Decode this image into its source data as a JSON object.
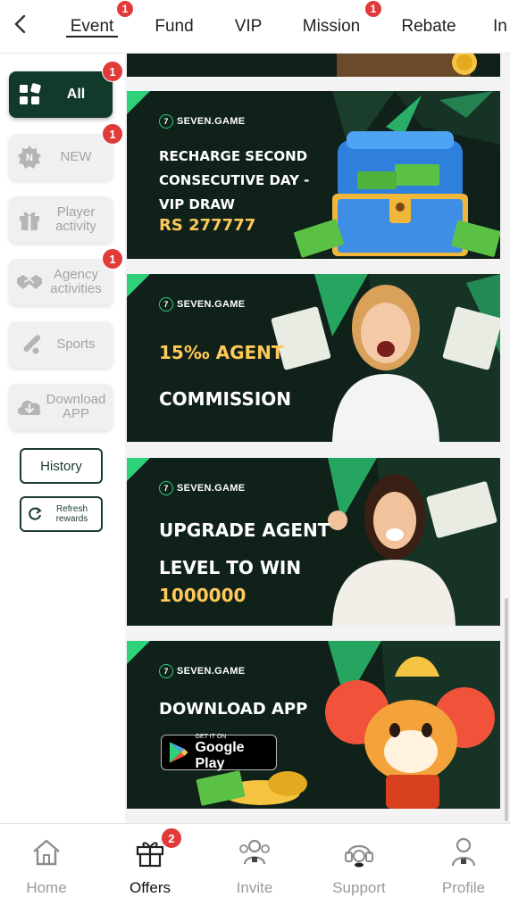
{
  "tabs": [
    {
      "label": "Event",
      "active": true,
      "badge": "1"
    },
    {
      "label": "Fund",
      "active": false,
      "badge": ""
    },
    {
      "label": "VIP",
      "active": false,
      "badge": ""
    },
    {
      "label": "Mission",
      "active": false,
      "badge": "1"
    },
    {
      "label": "Rebate",
      "active": false,
      "badge": ""
    },
    {
      "label": "In",
      "active": false,
      "badge": ""
    }
  ],
  "sidebar": {
    "items": [
      {
        "label": "All",
        "icon": "grid-icon",
        "badge": "1",
        "active": true
      },
      {
        "label": "NEW",
        "icon": "new-gear-icon",
        "badge": "1",
        "active": false
      },
      {
        "label": "Player activity",
        "icon": "gift-icon",
        "badge": "",
        "active": false
      },
      {
        "label": "Agency activities",
        "icon": "handshake-icon",
        "badge": "1",
        "active": false
      },
      {
        "label": "Sports",
        "icon": "bat-icon",
        "badge": "",
        "active": false
      },
      {
        "label": "Download APP",
        "icon": "cloud-download-icon",
        "badge": "",
        "active": false
      }
    ],
    "history_label": "History",
    "refresh_label": "Refresh rewards"
  },
  "banners": [
    {
      "brand": "SEVEN.GAME",
      "lines": [
        "RECHARGE SECOND",
        "CONSECUTIVE DAY -",
        "VIP DRAW"
      ],
      "highlight": "RS 277777"
    },
    {
      "brand": "SEVEN.GAME",
      "lines": [
        "15‰ AGENT",
        "COMMISSION"
      ],
      "highlight": ""
    },
    {
      "brand": "SEVEN.GAME",
      "lines": [
        "UPGRADE AGENT",
        "LEVEL TO WIN"
      ],
      "highlight": "1000000"
    },
    {
      "brand": "SEVEN.GAME",
      "lines": [
        "DOWNLOAD APP"
      ],
      "highlight": "",
      "store_small": "GET IT ON",
      "store_big": "Google Play"
    }
  ],
  "bottom_nav": [
    {
      "label": "Home",
      "icon": "home-icon",
      "active": false,
      "badge": ""
    },
    {
      "label": "Offers",
      "icon": "gift-box-icon",
      "active": true,
      "badge": "2"
    },
    {
      "label": "Invite",
      "icon": "people-icon",
      "active": false,
      "badge": ""
    },
    {
      "label": "Support",
      "icon": "headset-icon",
      "active": false,
      "badge": ""
    },
    {
      "label": "Profile",
      "icon": "user-icon",
      "active": false,
      "badge": ""
    }
  ],
  "colors": {
    "accent_dark": "#123a2a",
    "brand_green": "#2fd17a",
    "badge_red": "#e03a3a",
    "gold": "#ffc857"
  }
}
